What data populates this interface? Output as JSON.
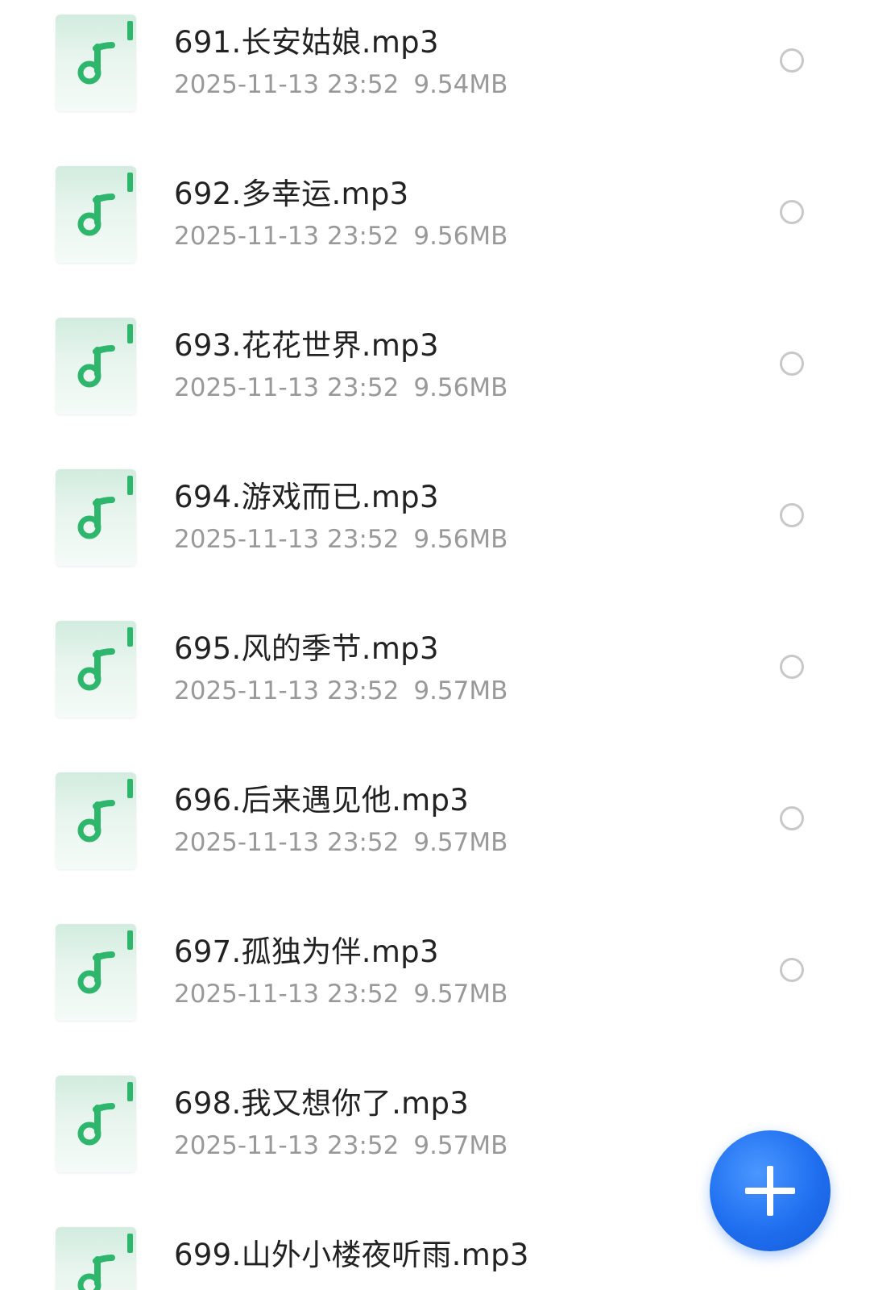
{
  "file_list": {
    "items": [
      {
        "name": "691.长安姑娘.mp3",
        "date": "2025-11-13 23:52",
        "size": "9.54MB",
        "icon": "music-file-icon",
        "selected": false
      },
      {
        "name": "692.多幸运.mp3",
        "date": "2025-11-13 23:52",
        "size": "9.56MB",
        "icon": "music-file-icon",
        "selected": false
      },
      {
        "name": "693.花花世界.mp3",
        "date": "2025-11-13 23:52",
        "size": "9.56MB",
        "icon": "music-file-icon",
        "selected": false
      },
      {
        "name": "694.游戏而已.mp3",
        "date": "2025-11-13 23:52",
        "size": "9.56MB",
        "icon": "music-file-icon",
        "selected": false
      },
      {
        "name": "695.风的季节.mp3",
        "date": "2025-11-13 23:52",
        "size": "9.57MB",
        "icon": "music-file-icon",
        "selected": false
      },
      {
        "name": "696.后来遇见他.mp3",
        "date": "2025-11-13 23:52",
        "size": "9.57MB",
        "icon": "music-file-icon",
        "selected": false
      },
      {
        "name": "697.孤独为伴.mp3",
        "date": "2025-11-13 23:52",
        "size": "9.57MB",
        "icon": "music-file-icon",
        "selected": false
      },
      {
        "name": "698.我又想你了.mp3",
        "date": "2025-11-13 23:52",
        "size": "9.57MB",
        "icon": "music-file-icon",
        "selected": false
      },
      {
        "name": "699.山外小楼夜听雨.mp3",
        "date": "",
        "size": "",
        "icon": "music-file-icon",
        "selected": false
      }
    ]
  },
  "fab": {
    "icon": "plus-icon"
  },
  "colors": {
    "accent_blue": "#1f6ff0",
    "icon_green": "#2fb66d",
    "text_primary": "#222222",
    "text_secondary": "#999999",
    "radio_border": "#c8c8c8"
  }
}
